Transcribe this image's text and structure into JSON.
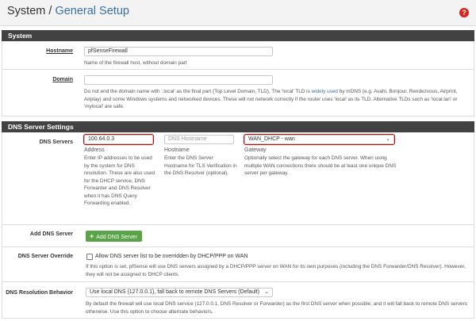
{
  "header": {
    "root": "System",
    "separator": " / ",
    "current": "General Setup",
    "help_icon_glyph": "?"
  },
  "system_panel": {
    "title": "System",
    "hostname": {
      "label": "Hostname",
      "value": "pfSenseFirewall",
      "help": "Name of the firewall host, without domain part"
    },
    "domain": {
      "label": "Domain",
      "value": "",
      "help_before_link": "Do not end the domain name with '.local' as the final part (Top Level Domain, TLD), The 'local' TLD is ",
      "help_link": "widely used",
      "help_after_link": " by mDNS (e.g. Avahi, Bonjour, Rendezvous, Airprint, Airplay) and some Windows systems and networked devices. These will not network correctly if the router uses 'local' as its TLD. Alternative TLDs such as 'local.lan' or 'mylocal' are safe."
    }
  },
  "dns_panel": {
    "title": "DNS Server Settings",
    "servers": {
      "label": "DNS Servers",
      "address_value": "100.64.0.3",
      "address_col_label": "Address",
      "address_help": "Enter IP addresses to be used by the system for DNS resolution. These are also used for the DHCP service, DNS Forwarder and DNS Resolver when it has DNS Query Forwarding enabled.",
      "hostname_placeholder": "DNS Hostname",
      "hostname_col_label": "Hostname",
      "hostname_help": "Enter the DNS Server Hostname for TLS Verification in the DNS Resolver (optional).",
      "gateway_value": "WAN_DHCP - wan",
      "gateway_col_label": "Gateway",
      "gateway_help": "Optionally select the gateway for each DNS server. When using multiple WAN connections there should be at least one unique DNS server per gateway."
    },
    "add_server": {
      "label": "Add DNS Server",
      "button_label": "Add DNS Server",
      "button_plus": "+"
    },
    "override": {
      "label": "DNS Server Override",
      "checkbox_label": "Allow DNS server list to be overridden by DHCP/PPP on WAN",
      "checked": false,
      "help": "If this option is set, pfSense will use DNS servers assigned by a DHCP/PPP server on WAN for its own purposes (including the DNS Forwarder/DNS Resolver). However, they will not be assigned to DHCP clients."
    },
    "resolution": {
      "label": "DNS Resolution Behavior",
      "selected": "Use local DNS (127.0.0.1), fall back to remote DNS Servers (Default)",
      "help": "By default the firewall will use local DNS service (127.0.0.1, DNS Resolver or Forwarder) as the first DNS server when possible, and it will fall back to remote DNS servers otherwise. Use this option to choose alternate behaviors."
    }
  },
  "colors": {
    "panel_header_bg": "#424242",
    "breadcrumb_link": "#3a6fa5",
    "highlight_outline": "#d40000",
    "add_button_bg": "#5aa348",
    "help_icon_bg": "#d9251d"
  },
  "icons": {
    "help": "question-circle-icon",
    "dropdown": "chevron-down-icon",
    "add": "plus-icon"
  }
}
